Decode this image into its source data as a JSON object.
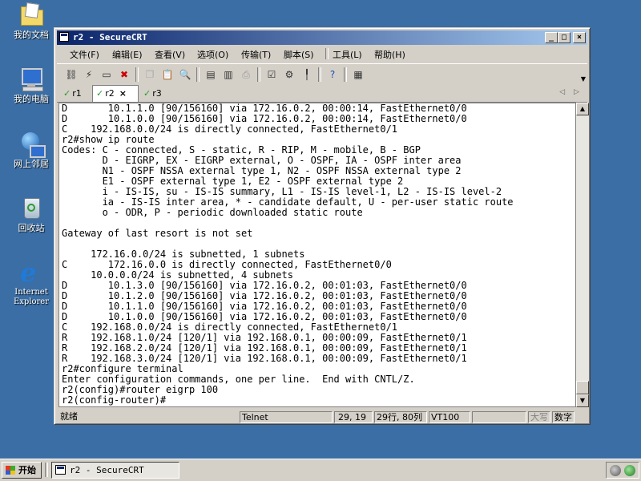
{
  "desktop": {
    "icons": [
      {
        "label": "我的文档",
        "icon": "my-documents-folder-icon"
      },
      {
        "label": "我的电脑",
        "icon": "my-computer-icon"
      },
      {
        "label": "网上邻居",
        "icon": "network-places-icon"
      },
      {
        "label": "回收站",
        "icon": "recycle-bin-icon"
      },
      {
        "label": "Internet Explorer",
        "icon": "internet-explorer-icon"
      }
    ]
  },
  "window": {
    "title": "r2 - SecureCRT",
    "menu": [
      "文件(F)",
      "编辑(E)",
      "查看(V)",
      "选项(O)",
      "传输(T)",
      "脚本(S)",
      "工具(L)",
      "帮助(H)"
    ],
    "toolbar_icons": [
      "connect-icon",
      "quick-connect-icon",
      "connect-tab-icon",
      "disconnect-icon",
      "copy-icon",
      "paste-icon",
      "find-icon",
      "print-setup-icon",
      "print-icon",
      "print-selection-icon",
      "session-options-icon",
      "global-options-icon",
      "keymap-icon",
      "help-icon",
      "about-icon"
    ],
    "tabs": [
      {
        "label": "r1",
        "active": false
      },
      {
        "label": "r2",
        "active": true
      },
      {
        "label": "r3",
        "active": false
      }
    ],
    "tab_close": "×",
    "terminal_lines": [
      "D       10.1.1.0 [90/156160] via 172.16.0.2, 00:00:14, FastEthernet0/0",
      "D       10.1.0.0 [90/156160] via 172.16.0.2, 00:00:14, FastEthernet0/0",
      "C    192.168.0.0/24 is directly connected, FastEthernet0/1",
      "r2#show ip route",
      "Codes: C - connected, S - static, R - RIP, M - mobile, B - BGP",
      "       D - EIGRP, EX - EIGRP external, O - OSPF, IA - OSPF inter area",
      "       N1 - OSPF NSSA external type 1, N2 - OSPF NSSA external type 2",
      "       E1 - OSPF external type 1, E2 - OSPF external type 2",
      "       i - IS-IS, su - IS-IS summary, L1 - IS-IS level-1, L2 - IS-IS level-2",
      "       ia - IS-IS inter area, * - candidate default, U - per-user static route",
      "       o - ODR, P - periodic downloaded static route",
      "",
      "Gateway of last resort is not set",
      "",
      "     172.16.0.0/24 is subnetted, 1 subnets",
      "C       172.16.0.0 is directly connected, FastEthernet0/0",
      "     10.0.0.0/24 is subnetted, 4 subnets",
      "D       10.1.3.0 [90/156160] via 172.16.0.2, 00:01:03, FastEthernet0/0",
      "D       10.1.2.0 [90/156160] via 172.16.0.2, 00:01:03, FastEthernet0/0",
      "D       10.1.1.0 [90/156160] via 172.16.0.2, 00:01:03, FastEthernet0/0",
      "D       10.1.0.0 [90/156160] via 172.16.0.2, 00:01:03, FastEthernet0/0",
      "C    192.168.0.0/24 is directly connected, FastEthernet0/1",
      "R    192.168.1.0/24 [120/1] via 192.168.0.1, 00:00:09, FastEthernet0/1",
      "R    192.168.2.0/24 [120/1] via 192.168.0.1, 00:00:09, FastEthernet0/1",
      "R    192.168.3.0/24 [120/1] via 192.168.0.1, 00:00:09, FastEthernet0/1",
      "r2#configure terminal",
      "Enter configuration commands, one per line.  End with CNTL/Z.",
      "r2(config)#router eigrp 100",
      "r2(config-router)#"
    ],
    "status": {
      "ready": "就绪",
      "protocol": "Telnet",
      "cursor_pos": "29, 19",
      "dimensions": "29行, 80列",
      "emulation": "VT100",
      "blank": "",
      "caps": "大写",
      "num": "数字"
    }
  },
  "taskbar": {
    "start_label": "开始",
    "task_label": "r2 - SecureCRT"
  }
}
